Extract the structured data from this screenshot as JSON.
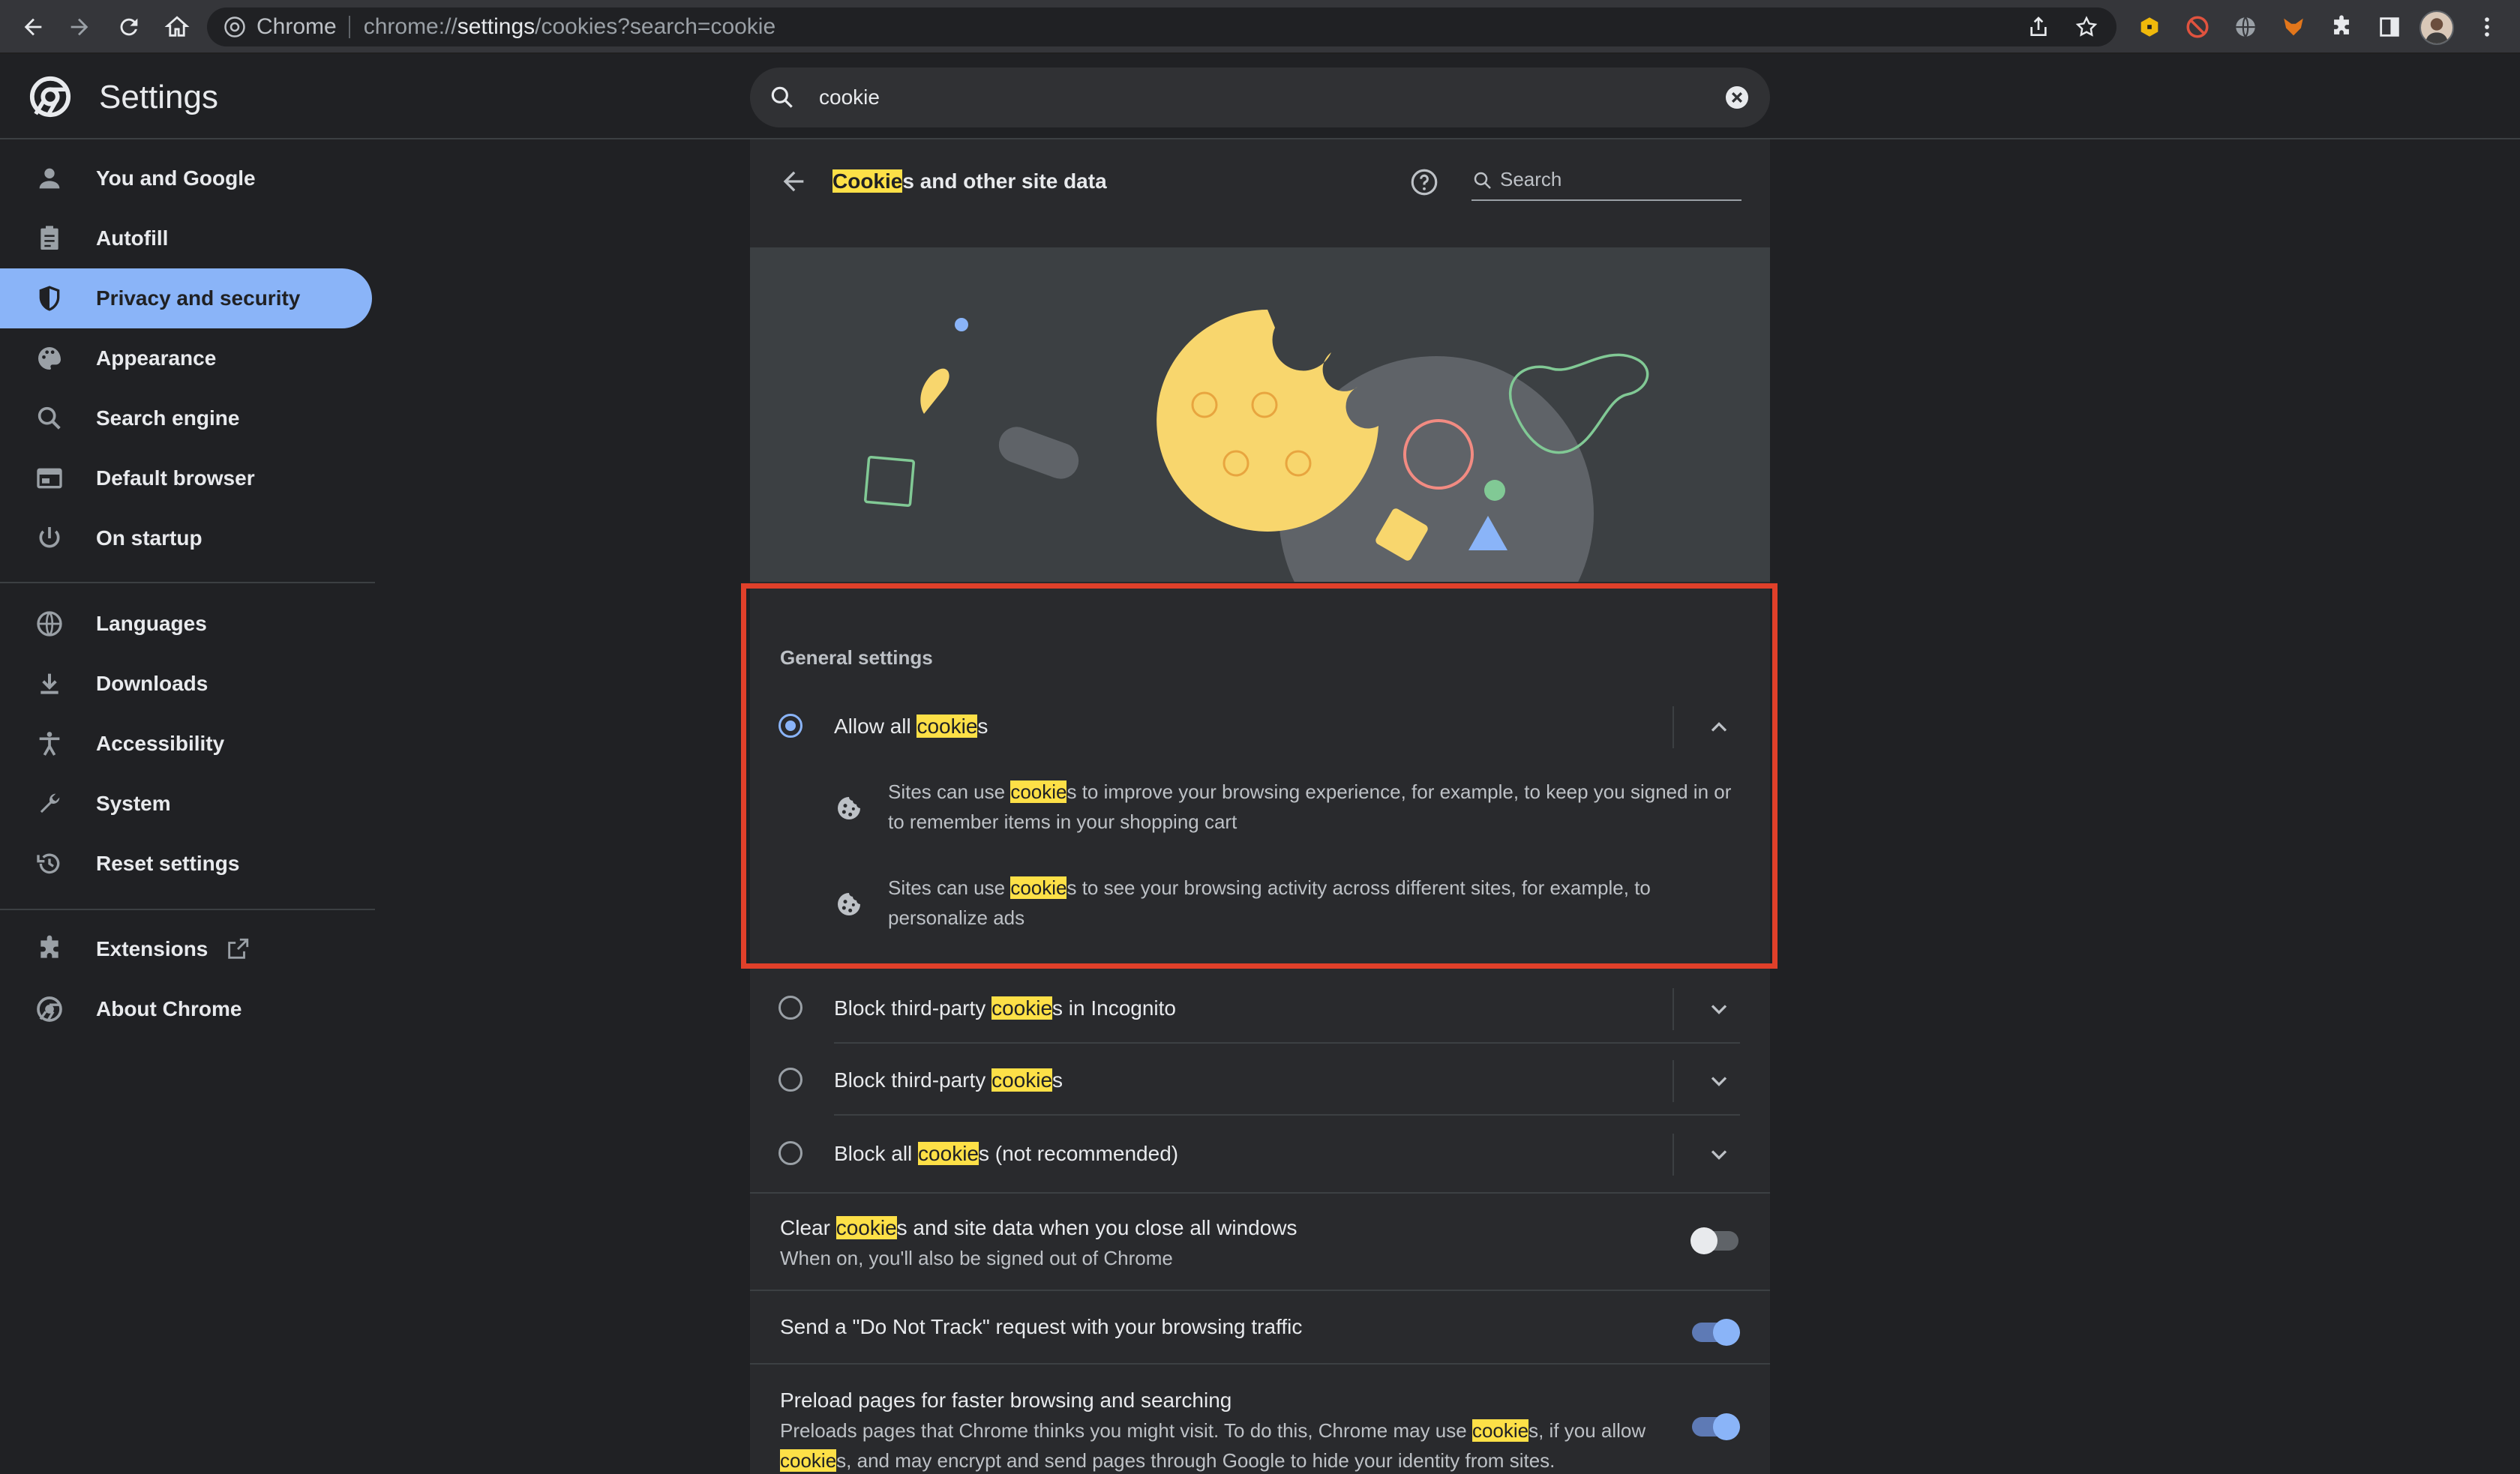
{
  "browser": {
    "site_name": "Chrome",
    "url_prefix": "chrome://",
    "url_host": "settings",
    "url_path": "/cookies?search=cookie"
  },
  "header": {
    "title": "Settings",
    "search_value": "cookie"
  },
  "sidebar": {
    "items": [
      {
        "label": "You and Google",
        "icon": "person-icon"
      },
      {
        "label": "Autofill",
        "icon": "clipboard-icon"
      },
      {
        "label": "Privacy and security",
        "icon": "shield-icon",
        "active": true
      },
      {
        "label": "Appearance",
        "icon": "palette-icon"
      },
      {
        "label": "Search engine",
        "icon": "search-icon"
      },
      {
        "label": "Default browser",
        "icon": "browser-icon"
      },
      {
        "label": "On startup",
        "icon": "power-icon"
      },
      {
        "label": "Languages",
        "icon": "globe-icon"
      },
      {
        "label": "Downloads",
        "icon": "download-icon"
      },
      {
        "label": "Accessibility",
        "icon": "accessibility-icon"
      },
      {
        "label": "System",
        "icon": "wrench-icon"
      },
      {
        "label": "Reset settings",
        "icon": "history-icon"
      },
      {
        "label": "Extensions",
        "icon": "puzzle-icon"
      },
      {
        "label": "About Chrome",
        "icon": "chrome-icon"
      }
    ]
  },
  "page": {
    "title_highlight": "Cookie",
    "title_rest": "s and other site data",
    "search_placeholder": "Search",
    "section_label": "General settings",
    "options": [
      {
        "pre": "Allow all ",
        "hl": "cookie",
        "post": "s",
        "selected": true,
        "expanded": true
      },
      {
        "pre": "Block third-party ",
        "hl": "cookie",
        "post": "s in Incognito",
        "selected": false
      },
      {
        "pre": "Block third-party ",
        "hl": "cookie",
        "post": "s",
        "selected": false
      },
      {
        "pre": "Block all ",
        "hl": "cookie",
        "post": "s (not recommended)",
        "selected": false
      }
    ],
    "allow_details": [
      {
        "pre": "Sites can use ",
        "hl": "cookie",
        "post": "s to improve your browsing experience, for example, to keep you signed in or to remember items in your shopping cart"
      },
      {
        "pre": "Sites can use ",
        "hl": "cookie",
        "post": "s to see your browsing activity across different sites, for example, to personalize ads"
      }
    ],
    "toggles": [
      {
        "title_pre": "Clear ",
        "title_hl": "cookie",
        "title_post": "s and site data when you close all windows",
        "sub": "When on, you'll also be signed out of Chrome",
        "on": false
      },
      {
        "title_pre": "Send a \"Do Not Track\" request with your browsing traffic",
        "on": true
      },
      {
        "title_pre": "Preload pages for faster browsing and searching",
        "sub_pre": "Preloads pages that Chrome thinks you might visit. To do this, Chrome may use ",
        "sub_hl1": "cookie",
        "sub_mid": "s, if you allow ",
        "sub_hl2": "cookie",
        "sub_post": "s, and may encrypt and send pages through Google to hide your identity from sites.",
        "on": true
      }
    ]
  },
  "colors": {
    "accent": "#8ab4f8",
    "highlight": "#fde047",
    "annotation_box": "#e0402a"
  }
}
